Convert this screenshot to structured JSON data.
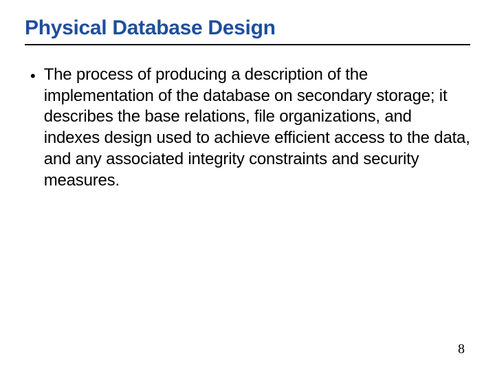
{
  "slide": {
    "title": "Physical Database Design",
    "bullets": [
      "The process of producing a description of the implementation of the database on secondary storage; it describes the base relations, file organizations, and indexes design used to achieve efficient access to the data, and any associated integrity constraints and security measures."
    ],
    "page_number": "8"
  }
}
